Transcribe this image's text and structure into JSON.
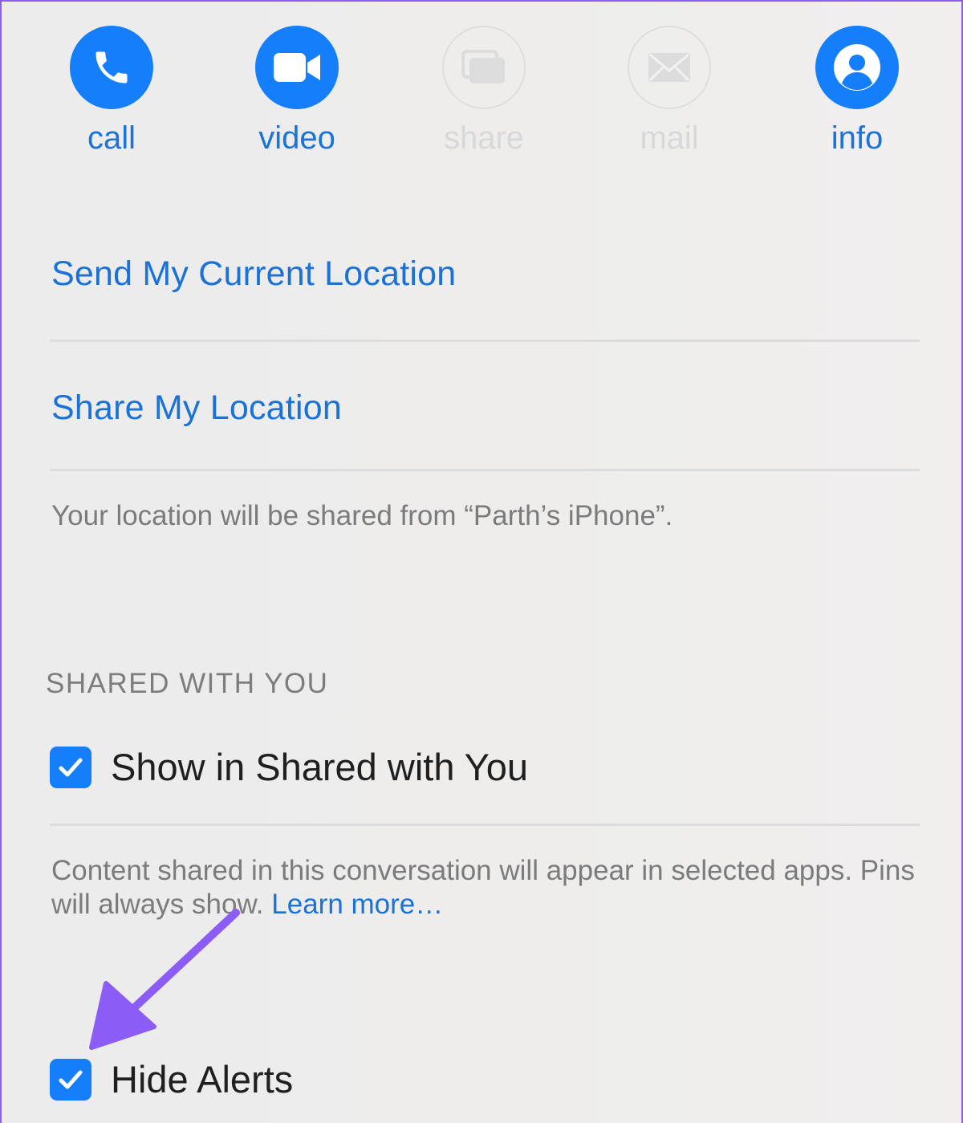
{
  "actions": [
    {
      "label": "call",
      "icon": "phone-icon",
      "enabled": true
    },
    {
      "label": "video",
      "icon": "video-camera-icon",
      "enabled": true
    },
    {
      "label": "share",
      "icon": "screen-share-icon",
      "enabled": false
    },
    {
      "label": "mail",
      "icon": "envelope-icon",
      "enabled": false
    },
    {
      "label": "info",
      "icon": "person-icon",
      "enabled": true
    }
  ],
  "location": {
    "send_current": "Send My Current Location",
    "share": "Share My Location",
    "note": "Your location will be shared from “Parth’s iPhone”."
  },
  "shared_with_you": {
    "header": "SHARED WITH YOU",
    "show_label": "Show in Shared with You",
    "show_checked": true,
    "note": "Content shared in this conversation will appear in selected apps. Pins will always show.",
    "learn_more": "Learn more…"
  },
  "alerts": {
    "hide_label": "Hide Alerts",
    "hide_checked": true
  },
  "colors": {
    "accent": "#147efb",
    "link": "#1b72d6",
    "annotation_arrow": "#8b5cf6"
  }
}
